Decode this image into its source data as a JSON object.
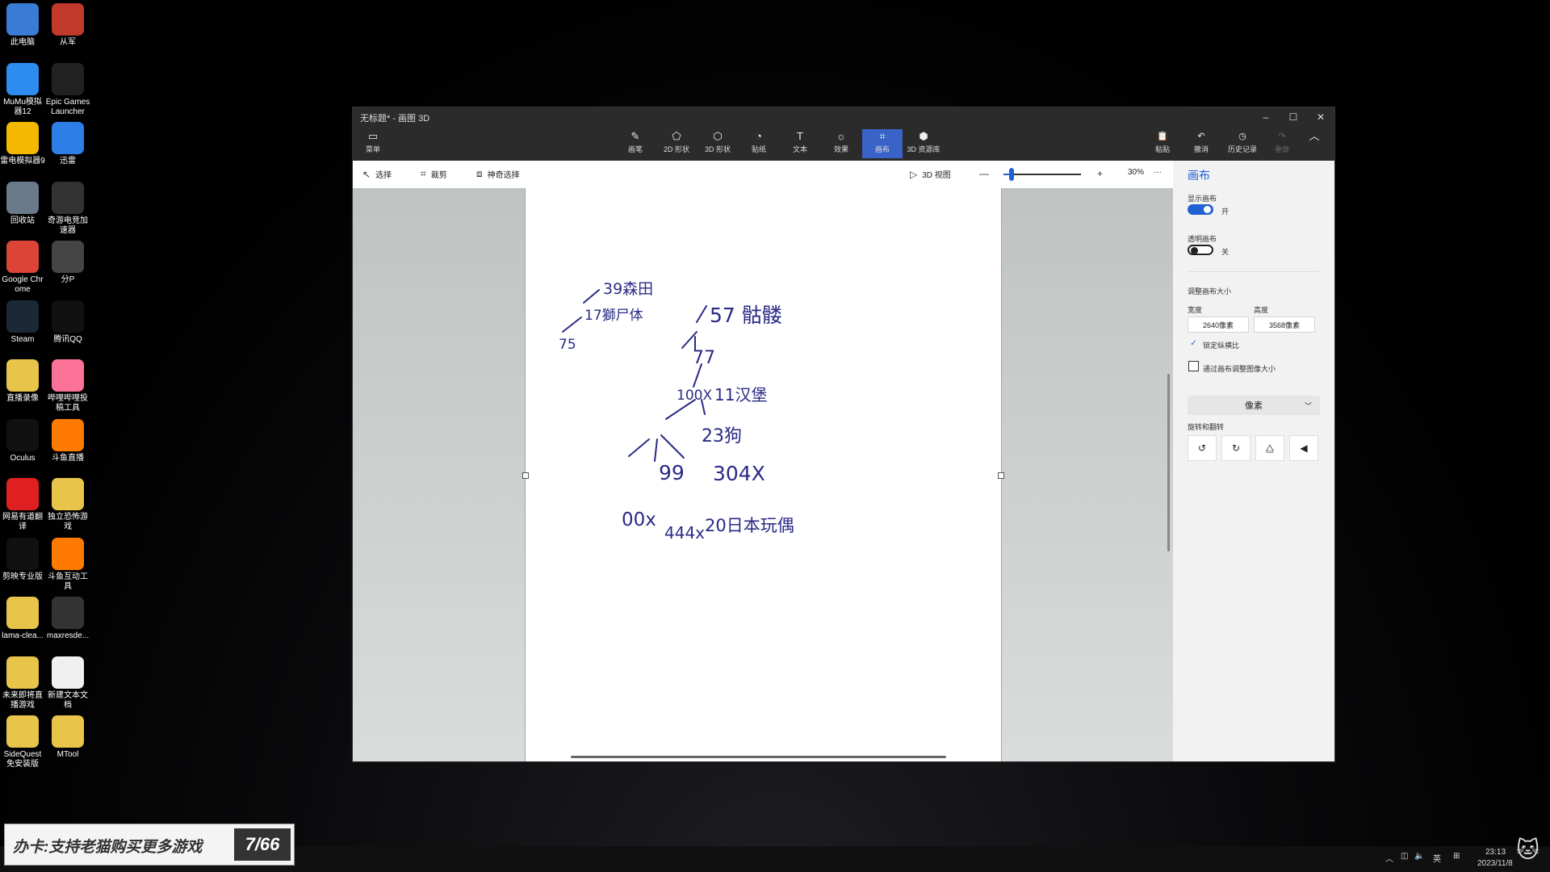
{
  "desktop_icons": [
    {
      "label": "此电脑",
      "icon": "computer-icon",
      "color": "#3a7bd5"
    },
    {
      "label": "从军",
      "icon": "star-game-icon",
      "color": "#c0392b"
    },
    {
      "label": "MuMu模拟器12",
      "icon": "mumu-icon",
      "color": "#2d8cf0"
    },
    {
      "label": "Epic Games Launcher",
      "icon": "epic-icon",
      "color": "#222222"
    },
    {
      "label": "雷电模拟器9",
      "icon": "leidian-icon",
      "color": "#f5b800"
    },
    {
      "label": "迅雷",
      "icon": "thunder-icon",
      "color": "#2e7ee8"
    },
    {
      "label": "回收站",
      "icon": "recycle-bin-icon",
      "color": "#6a7a8a"
    },
    {
      "label": "奇游电竞加速器",
      "icon": "qiyou-icon",
      "color": "#333333"
    },
    {
      "label": "Google Chrome",
      "icon": "chrome-icon",
      "color": "#db4437"
    },
    {
      "label": "分P",
      "icon": "video-file-icon",
      "color": "#444444"
    },
    {
      "label": "Steam",
      "icon": "steam-icon",
      "color": "#1b2838"
    },
    {
      "label": "腾讯QQ",
      "icon": "qq-icon",
      "color": "#111111"
    },
    {
      "label": "直播录像",
      "icon": "folder-icon",
      "color": "#e8c44a"
    },
    {
      "label": "哔哩哔哩投稿工具",
      "icon": "bilibili-icon",
      "color": "#fb7299"
    },
    {
      "label": "Oculus",
      "icon": "oculus-icon",
      "color": "#111111"
    },
    {
      "label": "斗鱼直播",
      "icon": "douyu-icon",
      "color": "#ff7a00"
    },
    {
      "label": "网易有道翻译",
      "icon": "youdao-icon",
      "color": "#e02020"
    },
    {
      "label": "独立恐怖游戏",
      "icon": "folder-icon",
      "color": "#e8c44a"
    },
    {
      "label": "剪映专业版",
      "icon": "capcut-icon",
      "color": "#111111"
    },
    {
      "label": "斗鱼互动工具",
      "icon": "douyu-tool-icon",
      "color": "#ff7a00"
    },
    {
      "label": "lama-clea...",
      "icon": "folder-icon",
      "color": "#e8c44a"
    },
    {
      "label": "maxresde...",
      "icon": "image-file-icon",
      "color": "#333333"
    },
    {
      "label": "未来即将直播游戏",
      "icon": "folder-icon",
      "color": "#e8c44a"
    },
    {
      "label": "新建文本文档",
      "icon": "text-file-icon",
      "color": "#f0f0f0"
    },
    {
      "label": "SideQuest免安装版",
      "icon": "folder-icon",
      "color": "#e8c44a"
    },
    {
      "label": "MTool",
      "icon": "folder-icon",
      "color": "#e8c44a"
    }
  ],
  "window": {
    "title": "无标题* - 画图 3D",
    "minimize": "–",
    "maximize": "☐",
    "close": "✕"
  },
  "toolbar": {
    "menu_label": "菜单",
    "tools": [
      {
        "label": "画笔",
        "icon": "brush-icon",
        "glyph": "✎"
      },
      {
        "label": "2D 形状",
        "icon": "shape-2d-icon",
        "glyph": "⬠"
      },
      {
        "label": "3D 形状",
        "icon": "shape-3d-icon",
        "glyph": "⬡"
      },
      {
        "label": "贴纸",
        "icon": "sticker-icon",
        "glyph": "◔"
      },
      {
        "label": "文本",
        "icon": "text-icon",
        "glyph": "T"
      },
      {
        "label": "效果",
        "icon": "effects-icon",
        "glyph": "☼"
      },
      {
        "label": "画布",
        "icon": "canvas-icon",
        "glyph": "⌗"
      },
      {
        "label": "3D 资源库",
        "icon": "library-3d-icon",
        "glyph": "⬢"
      }
    ],
    "active_tool": "画布",
    "right": [
      {
        "label": "粘贴",
        "icon": "paste-icon",
        "glyph": "📋"
      },
      {
        "label": "撤消",
        "icon": "undo-icon",
        "glyph": "↶"
      },
      {
        "label": "历史记录",
        "icon": "history-icon",
        "glyph": "◷"
      },
      {
        "label": "重做",
        "icon": "redo-icon",
        "glyph": "↷"
      }
    ]
  },
  "subbar": {
    "select": "选择",
    "crop": "裁剪",
    "magic_select": "神奇选择",
    "view3d": "3D 视图",
    "zoom_percent": "30%",
    "zoom_level": 0.1,
    "more": "···",
    "zoom_out": "—",
    "zoom_in": "+"
  },
  "panel": {
    "title": "画布",
    "show_canvas": "显示画布",
    "show_canvas_state": "开",
    "transparent_canvas": "透明画布",
    "transparent_canvas_state": "关",
    "resize": "调整画布大小",
    "width_label": "宽度",
    "height_label": "高度",
    "width": "2640像素",
    "height": "3568像素",
    "lock_ratio": "锁定纵横比",
    "resize_image": "通过画布调整图像大小",
    "unit": "像素",
    "rotate_flip": "旋转和翻转"
  },
  "drawing": {
    "n39": "39森田",
    "n17": "17獅尸体",
    "n75": "75",
    "n57": "57 骷髅",
    "n77": "77",
    "n100x": "100X",
    "n11": "11汉堡",
    "n23": "23狗",
    "n99": "99",
    "n304": "304X",
    "n00": "00x",
    "n444": "444x",
    "n20": "20日本玩偶"
  },
  "taskbar": {
    "time": "23:13",
    "date": "2023/11/8",
    "ime": "英",
    "banner_text": "办卡:支持老猫购买更多游戏",
    "banner_badge": "7/66"
  }
}
